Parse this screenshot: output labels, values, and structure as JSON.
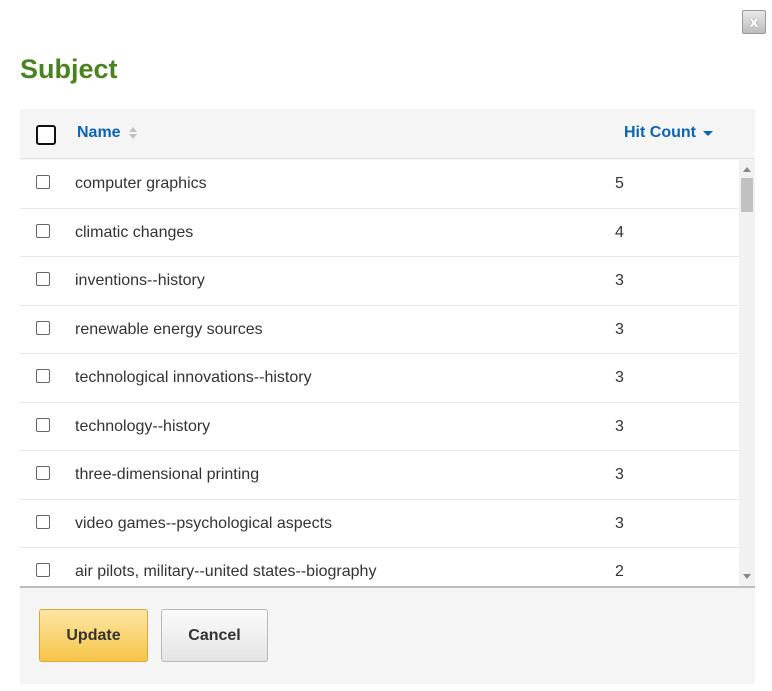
{
  "dialog": {
    "close_label": "x",
    "title": "Subject"
  },
  "table": {
    "columns": {
      "name": "Name",
      "hit_count": "Hit Count"
    },
    "sort": {
      "column": "hit_count",
      "direction": "descending"
    },
    "rows": [
      {
        "name": "computer graphics",
        "count": "5",
        "checked": false
      },
      {
        "name": "climatic changes",
        "count": "4",
        "checked": false
      },
      {
        "name": "inventions--history",
        "count": "3",
        "checked": false
      },
      {
        "name": "renewable energy sources",
        "count": "3",
        "checked": false
      },
      {
        "name": "technological innovations--history",
        "count": "3",
        "checked": false
      },
      {
        "name": "technology--history",
        "count": "3",
        "checked": false
      },
      {
        "name": "three-dimensional printing",
        "count": "3",
        "checked": false
      },
      {
        "name": "video games--psychological aspects",
        "count": "3",
        "checked": false
      },
      {
        "name": "air pilots, military--united states--biography",
        "count": "2",
        "checked": false
      }
    ]
  },
  "buttons": {
    "update": "Update",
    "cancel": "Cancel"
  },
  "colors": {
    "title": "#4a8221",
    "link": "#0b63b6",
    "primary_button": "#f6c547"
  }
}
